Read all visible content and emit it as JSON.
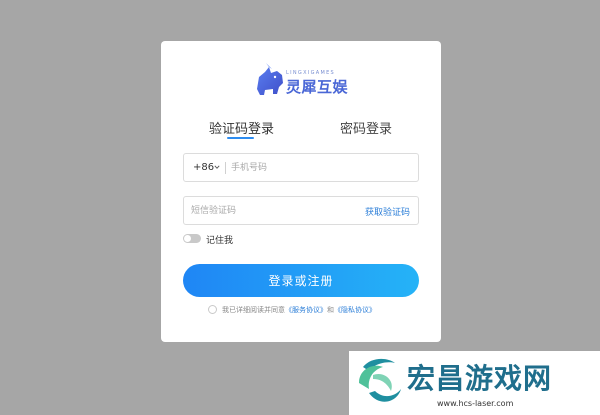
{
  "brand": {
    "sub": "LINGXIGAMES",
    "name": "灵犀互娱",
    "color": "#4a67d6"
  },
  "tabs": [
    {
      "label": "验证码登录",
      "active": true
    },
    {
      "label": "密码登录",
      "active": false
    }
  ],
  "phone": {
    "country_code": "+86",
    "placeholder": "手机号码",
    "value": ""
  },
  "sms": {
    "placeholder": "短信验证码",
    "value": "",
    "get_code_label": "获取验证码"
  },
  "remember": {
    "label": "记住我",
    "checked": false
  },
  "login_button": {
    "label": "登录或注册"
  },
  "agreement": {
    "prefix": "我已详细阅读并同意",
    "service": "《服务协议》",
    "and": "和",
    "privacy": "《隐私协议》",
    "checked": false
  },
  "watermark": {
    "name": "宏昌游戏网",
    "url": "www.hcs-laser.com"
  },
  "colors": {
    "background": "#a6a6a6",
    "accent": "#2d8cf0",
    "link": "#2d7fd8"
  }
}
